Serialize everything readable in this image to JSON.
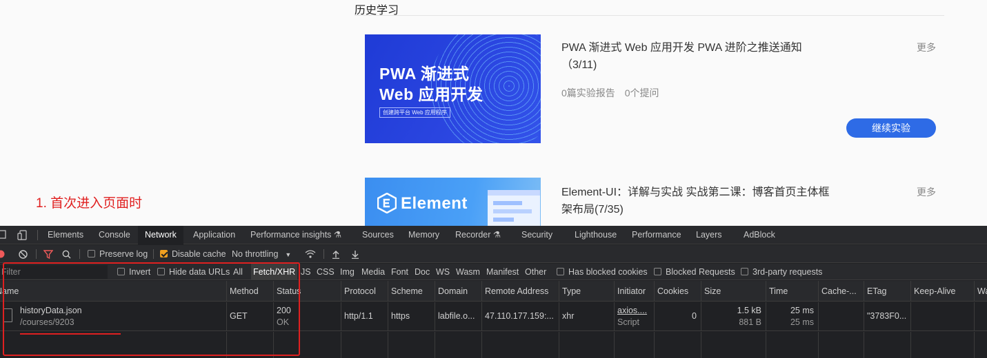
{
  "site": {
    "section_title": "历史学习",
    "courses": [
      {
        "thumb_line1": "PWA 渐进式",
        "thumb_line2": "Web 应用开发",
        "thumb_sub": "创建跨平台 Web 应用程序",
        "title": "PWA 渐进式 Web 应用开发 PWA 进阶之推送通知（3/11)",
        "more": "更多",
        "reports": "0篇实验报告",
        "questions": "0个提问",
        "button": "继续实验"
      },
      {
        "thumb_text": "Element",
        "title": "Element-UI：详解与实战 实战第二课：博客首页主体框架布局(7/35)",
        "more": "更多"
      }
    ],
    "annotation": "1. 首次进入页面时"
  },
  "devtools": {
    "tabs": [
      "Elements",
      "Console",
      "Network",
      "Application",
      "Performance insights ⚗",
      "Sources",
      "Memory",
      "Recorder ⚗",
      "Security",
      "Lighthouse",
      "Performance",
      "Layers",
      "AdBlock"
    ],
    "active_tab": "Network",
    "toolbar": {
      "preserve_log": "Preserve log",
      "disable_cache": "Disable cache",
      "throttling": "No throttling"
    },
    "filter": {
      "placeholder": "Filter",
      "invert": "Invert",
      "hide_data_urls": "Hide data URLs",
      "types": [
        "All",
        "Fetch/XHR",
        "JS",
        "CSS",
        "Img",
        "Media",
        "Font",
        "Doc",
        "WS",
        "Wasm",
        "Manifest",
        "Other"
      ],
      "active_type": "Fetch/XHR",
      "blocked_cookies": "Has blocked cookies",
      "blocked_requests": "Blocked Requests",
      "third_party": "3rd-party requests"
    },
    "columns": [
      "Name",
      "Method",
      "Status",
      "Protocol",
      "Scheme",
      "Domain",
      "Remote Address",
      "Type",
      "Initiator",
      "Cookies",
      "Size",
      "Time",
      "Cache-...",
      "ETag",
      "Keep-Alive",
      "Wa"
    ],
    "request": {
      "name": "historyData.json",
      "path": "/courses/9203",
      "method": "GET",
      "status_code": "200",
      "status_text": "OK",
      "protocol": "http/1.1",
      "scheme": "https",
      "domain": "labfile.o...",
      "remote_address": "47.110.177.159:...",
      "type": "xhr",
      "initiator": "axios....",
      "initiator_type": "Script",
      "cookies": "0",
      "size": "1.5 kB",
      "size_resource": "881 B",
      "time": "25 ms",
      "time_latency": "25 ms",
      "etag": "\"3783F0..."
    }
  },
  "colors": {
    "accent_blue": "#2e6be6",
    "annotation_red": "#e02020",
    "devtools_bg": "#202124",
    "checkbox_orange": "#f0a020"
  }
}
